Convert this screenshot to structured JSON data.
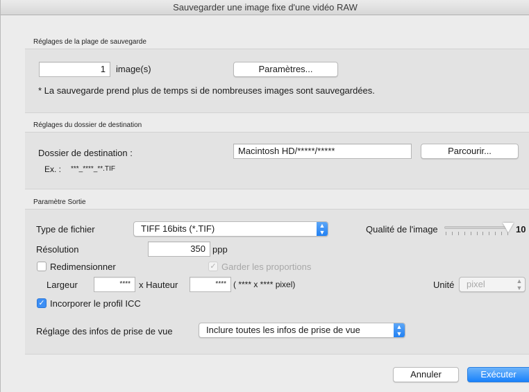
{
  "window": {
    "title": "Sauvegarder une image fixe d'une vidéo RAW"
  },
  "save_range": {
    "section_title": "Réglages de la plage de sauvegarde",
    "count_value": "1",
    "count_unit": "image(s)",
    "params_button": "Paramètres...",
    "note": "* La sauvegarde prend plus de temps si de nombreuses images sont sauvegardées."
  },
  "destination": {
    "section_title": "Réglages du dossier de destination",
    "label": "Dossier de destination :",
    "path_value": "Macintosh HD/*****/*****",
    "browse_button": "Parcourir...",
    "example_label": "Ex. :",
    "example_value": "***_****_**.TIF"
  },
  "output": {
    "section_title": "Paramètre Sortie",
    "file_type_label": "Type de fichier",
    "file_type_value": "TIFF 16bits (*.TIF)",
    "quality_label": "Qualité de l'image",
    "quality_value": "10",
    "quality_level": 10,
    "quality_max": 10,
    "resolution_label": "Résolution",
    "resolution_value": "350",
    "resolution_unit": "ppp",
    "resize_label": "Redimensionner",
    "resize_checked": false,
    "keep_proportions_label": "Garder les proportions",
    "keep_proportions_checked": true,
    "width_label": "Largeur",
    "width_value": "****",
    "height_label": "x  Hauteur",
    "height_value": "****",
    "size_readout": "( ****  x  ****  pixel)",
    "unit_label": "Unité",
    "unit_value": "pixel",
    "icc_label": "Incorporer le profil ICC",
    "icc_checked": true,
    "shooting_info_label": "Réglage des infos de prise de vue",
    "shooting_info_value": "Inclure toutes les infos de prise de vue"
  },
  "footer": {
    "cancel_button": "Annuler",
    "execute_button": "Exécuter"
  },
  "colors": {
    "accent": "#1a82fb",
    "group_bg": "#e3e3e3",
    "window_bg": "#ececec"
  }
}
